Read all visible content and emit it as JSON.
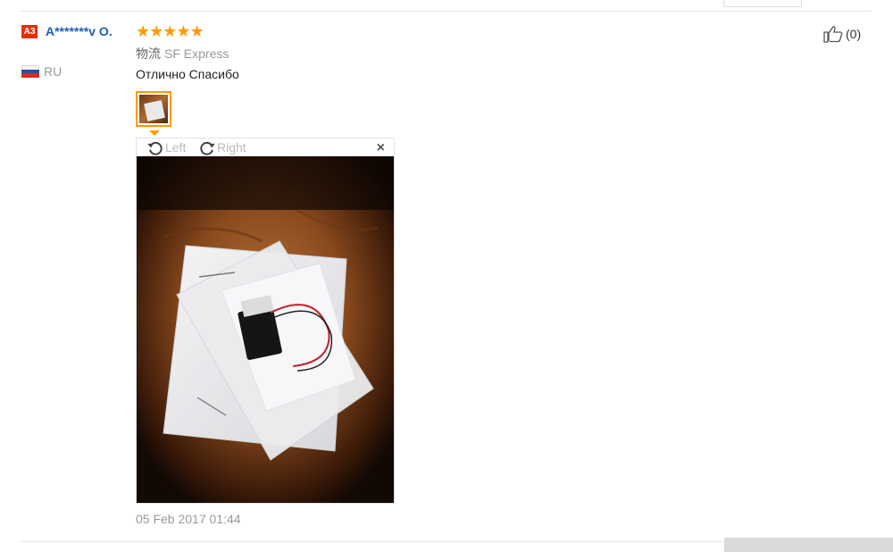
{
  "review": {
    "badge": "A3",
    "user_name": "A*******v O.",
    "country": "RU",
    "rating": 5,
    "stars": "★★★★★",
    "logistics_label": "物流",
    "logistics_value": "SF Express",
    "text": "Отлично Спасибо",
    "date": "05 Feb 2017 01:44",
    "helpful_count": "(0)"
  },
  "viewer": {
    "rotate_left_label": "Left",
    "rotate_right_label": "Right",
    "close_label": "×"
  },
  "colors": {
    "star": "#ff9a00",
    "link": "#1f5eb0",
    "badge": "#e62e04",
    "thumb_border": "#ff9a00"
  },
  "icons": {
    "rotate_left": "rotate-left-icon",
    "rotate_right": "rotate-right-icon",
    "close": "close-icon",
    "thumbs_up": "thumbs-up-icon",
    "flag": "russia-flag-icon"
  }
}
